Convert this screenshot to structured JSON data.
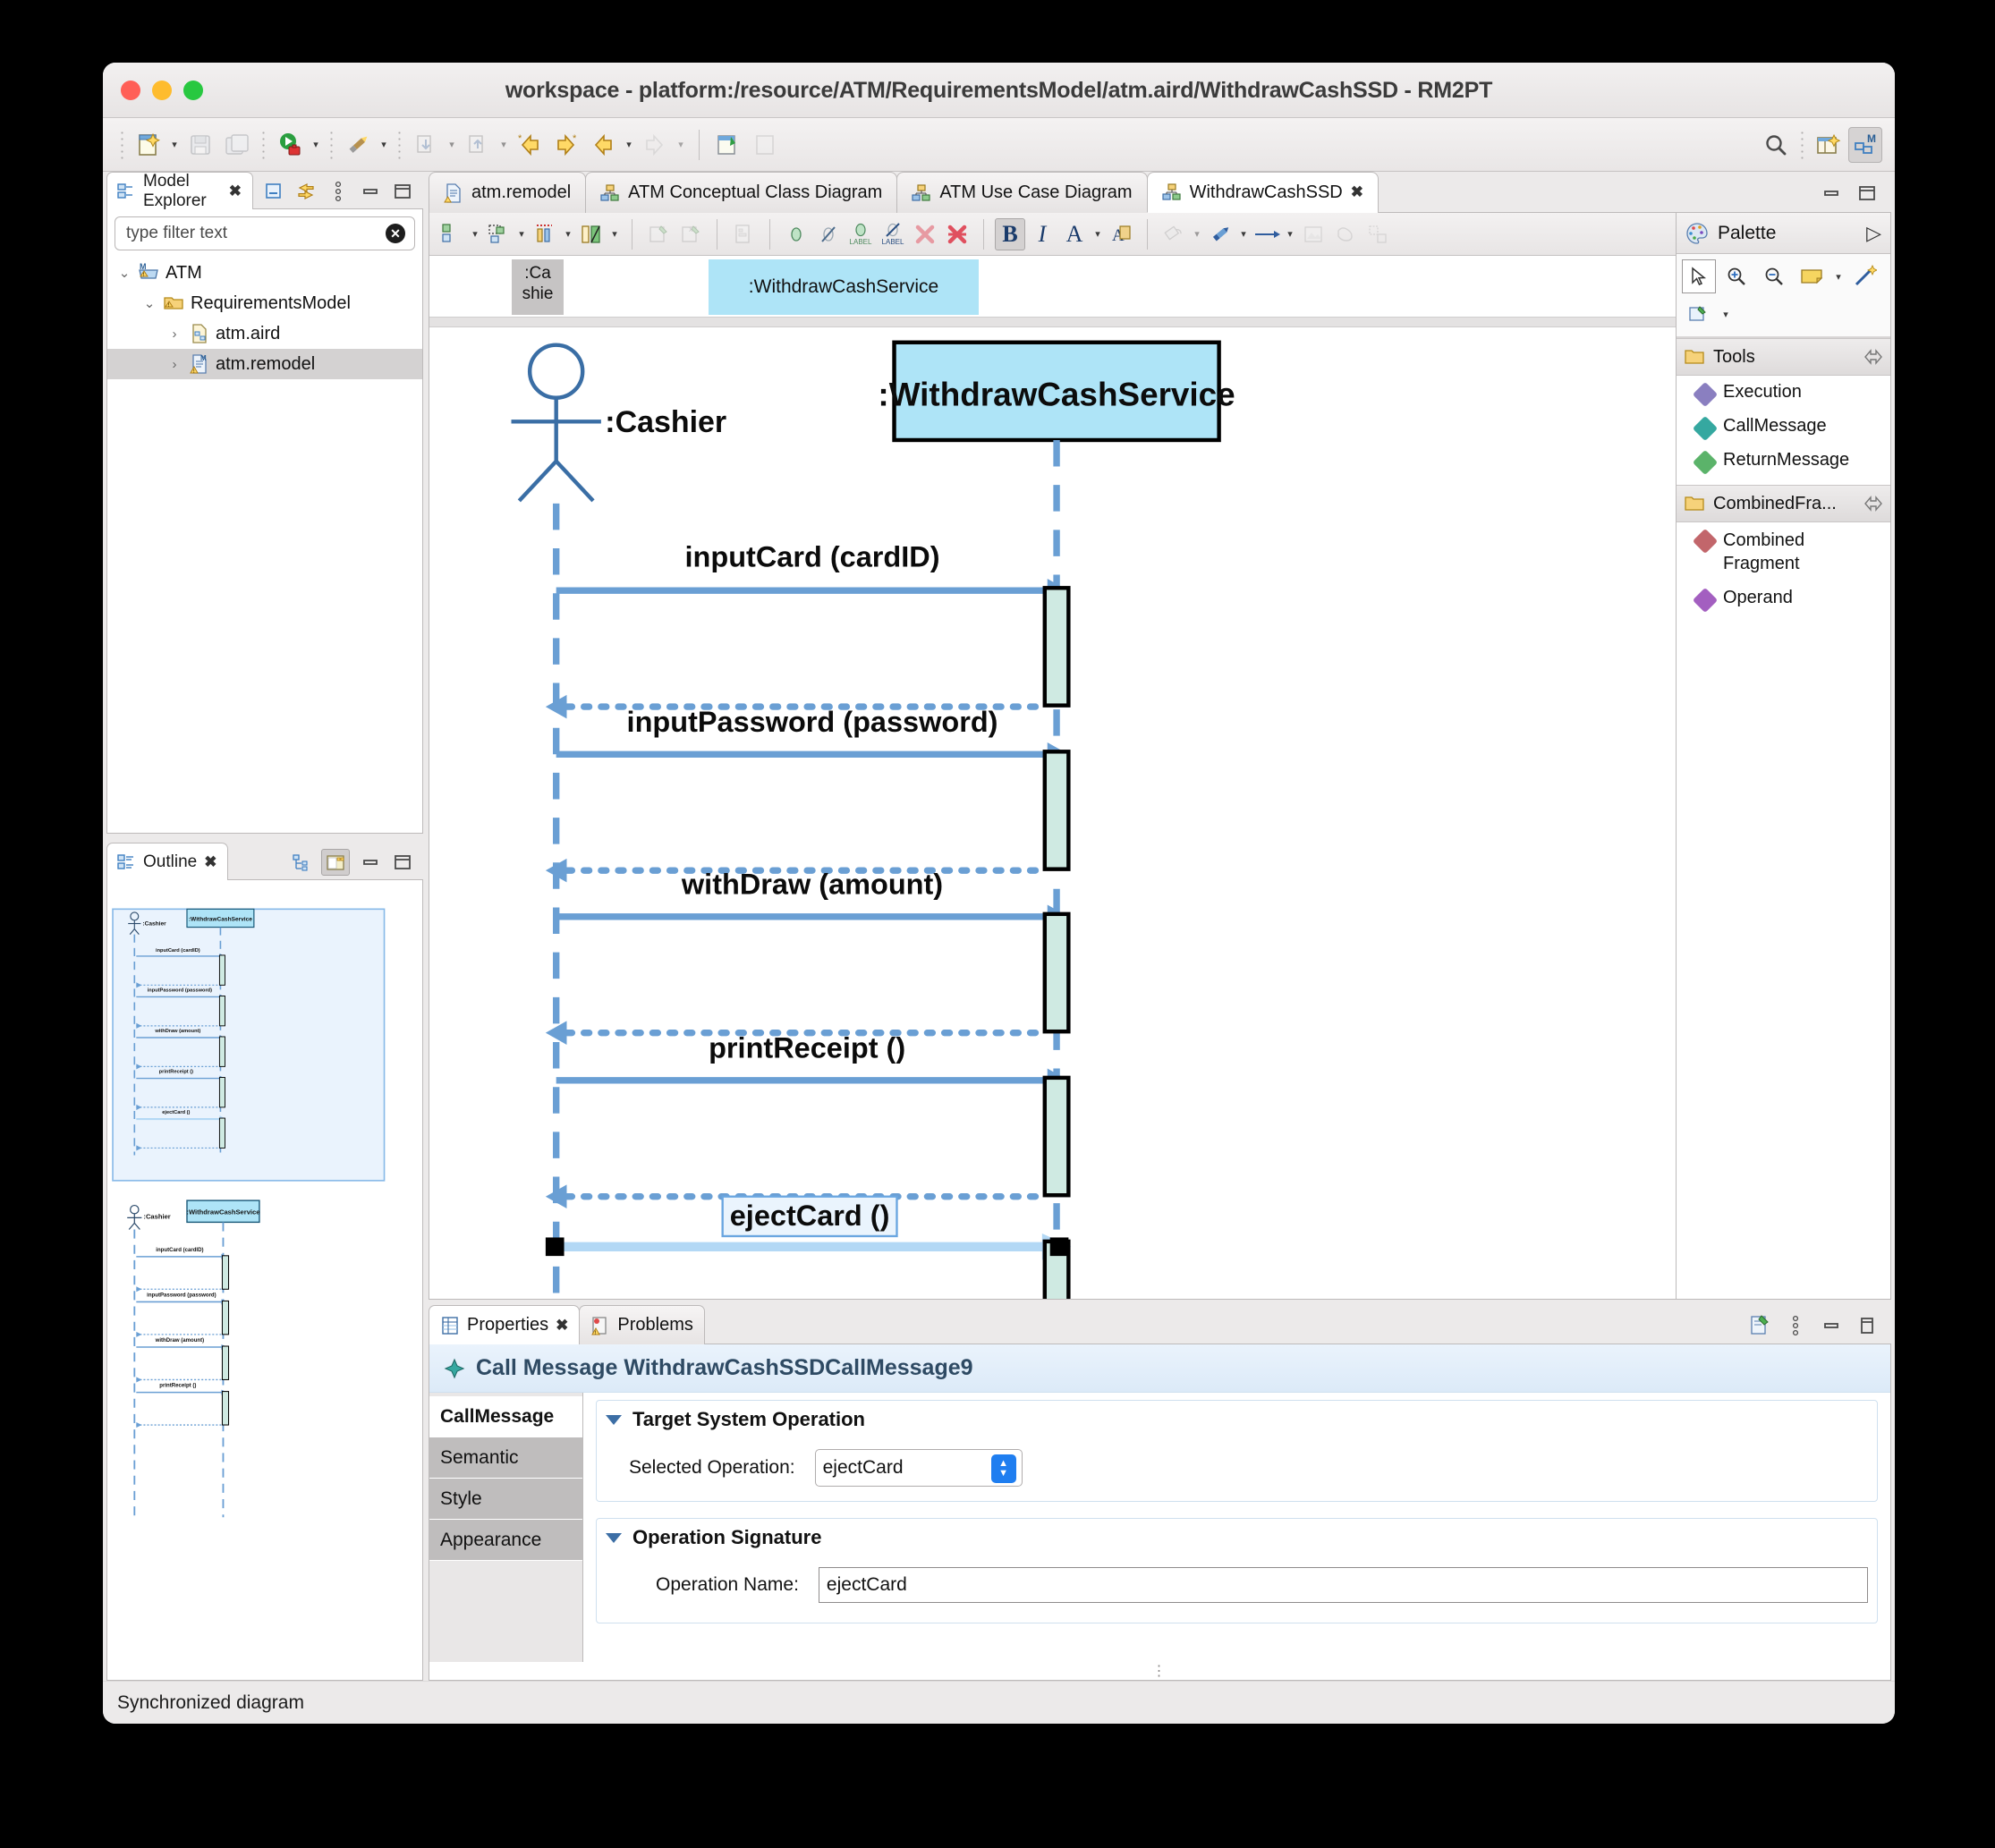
{
  "window": {
    "title": "workspace - platform:/resource/ATM/RequirementsModel/atm.aird/WithdrawCashSSD - RM2PT",
    "traffic": {
      "close": "close-button",
      "minimize": "minimize-button",
      "zoom": "zoom-button"
    }
  },
  "main_toolbar": {
    "items": [
      {
        "name": "new-wizard",
        "glyph": "new",
        "caret": true,
        "enabled": true
      },
      {
        "name": "save",
        "glyph": "save",
        "caret": false,
        "enabled": false
      },
      {
        "name": "save-all",
        "glyph": "save-all",
        "caret": false,
        "enabled": false
      },
      {
        "name": "run",
        "glyph": "run",
        "caret": true,
        "enabled": true
      },
      {
        "name": "validate",
        "glyph": "pencil",
        "caret": true,
        "enabled": true
      },
      {
        "name": "import",
        "glyph": "import",
        "caret": true,
        "enabled": false
      },
      {
        "name": "export",
        "glyph": "export",
        "caret": true,
        "enabled": false
      },
      {
        "name": "previous-annotation",
        "glyph": "prev-annot",
        "caret": false,
        "enabled": true
      },
      {
        "name": "next-annotation",
        "glyph": "next-annot",
        "caret": false,
        "enabled": true
      },
      {
        "name": "back",
        "glyph": "back",
        "caret": true,
        "enabled": true
      },
      {
        "name": "forward",
        "glyph": "forward",
        "caret": true,
        "enabled": false
      },
      {
        "name": "new-representation",
        "glyph": "new-repr",
        "caret": false,
        "enabled": true
      },
      {
        "name": "open-representation",
        "glyph": "open-repr",
        "caret": false,
        "enabled": false
      }
    ],
    "right_items": [
      {
        "name": "search-icon",
        "glyph": "search"
      },
      {
        "name": "open-perspective",
        "glyph": "perspective"
      },
      {
        "name": "modeling-perspective",
        "glyph": "modeling",
        "active": true
      }
    ]
  },
  "model_explorer": {
    "tab_label": "Model Explorer",
    "close_glyph": "✖",
    "toolbar": [
      {
        "name": "collapse-all-icon"
      },
      {
        "name": "link-with-editor-icon"
      },
      {
        "name": "view-menu-icon"
      },
      {
        "name": "minimize-icon"
      },
      {
        "name": "maximize-icon"
      }
    ],
    "filter_placeholder": "type filter text",
    "filter_value": "",
    "tree": [
      {
        "label": "ATM",
        "depth": 0,
        "expanded": true,
        "icon": "model-project-icon",
        "warning": true,
        "selected": false
      },
      {
        "label": "RequirementsModel",
        "depth": 1,
        "expanded": true,
        "icon": "folder-icon",
        "warning": true,
        "selected": false
      },
      {
        "label": "atm.aird",
        "depth": 2,
        "expanded": false,
        "icon": "aird-file-icon",
        "warning": false,
        "selected": false
      },
      {
        "label": "atm.remodel",
        "depth": 2,
        "expanded": false,
        "icon": "remodel-file-icon",
        "warning": true,
        "selected": true
      }
    ]
  },
  "outline": {
    "tab_label": "Outline",
    "close_glyph": "✖",
    "toolbar": [
      {
        "name": "outline-tree-view-icon",
        "active": false
      },
      {
        "name": "outline-overview-icon",
        "active": true
      },
      {
        "name": "minimize-icon",
        "active": false
      },
      {
        "name": "maximize-icon",
        "active": false
      }
    ]
  },
  "editor": {
    "tabs": [
      {
        "label": "atm.remodel",
        "icon": "remodel-file-icon",
        "active": false,
        "closable": false
      },
      {
        "label": "ATM Conceptual Class Diagram",
        "icon": "diagram-icon",
        "active": false,
        "closable": false
      },
      {
        "label": "ATM Use Case Diagram",
        "icon": "diagram-icon",
        "active": false,
        "closable": false
      },
      {
        "label": "WithdrawCashSSD",
        "icon": "diagram-icon",
        "active": true,
        "closable": true
      }
    ],
    "tab_controls": [
      {
        "name": "minimize-icon"
      },
      {
        "name": "maximize-icon"
      }
    ],
    "diagram_toolbar": [
      {
        "name": "align-icon",
        "caret": true,
        "enabled": true
      },
      {
        "name": "distribute-icon",
        "caret": true,
        "enabled": true
      },
      {
        "name": "auto-size-icon",
        "caret": true,
        "enabled": true
      },
      {
        "name": "arrange-icon",
        "caret": true,
        "enabled": true
      },
      {
        "name": "pin-icon",
        "caret": false,
        "enabled": false
      },
      {
        "name": "unpin-icon",
        "caret": false,
        "enabled": false
      },
      {
        "name": "paste-format-icon",
        "caret": false,
        "enabled": false
      },
      {
        "name": "show-hide-icon",
        "caret": false,
        "enabled": true
      },
      {
        "name": "hide-element-icon",
        "caret": false,
        "enabled": true
      },
      {
        "name": "show-label-icon",
        "caret": false,
        "enabled": true
      },
      {
        "name": "hide-label-icon",
        "caret": false,
        "enabled": true
      },
      {
        "name": "delete-from-diagram-icon",
        "caret": false,
        "enabled": true
      },
      {
        "name": "delete-from-model-icon",
        "caret": false,
        "enabled": true
      },
      {
        "name": "bold-icon",
        "caret": false,
        "enabled": true,
        "active": true,
        "text": "B"
      },
      {
        "name": "italic-icon",
        "caret": false,
        "enabled": true,
        "text": "I"
      },
      {
        "name": "font-color-icon",
        "caret": true,
        "enabled": true,
        "text": "A"
      },
      {
        "name": "font-dialog-icon",
        "caret": false,
        "enabled": true
      },
      {
        "name": "fill-color-icon",
        "caret": true,
        "enabled": false
      },
      {
        "name": "line-color-icon",
        "caret": true,
        "enabled": true
      },
      {
        "name": "line-style-icon",
        "caret": true,
        "enabled": true
      },
      {
        "name": "image-icon",
        "caret": false,
        "enabled": false
      },
      {
        "name": "shape-icon",
        "caret": false,
        "enabled": false
      },
      {
        "name": "layers-icon",
        "caret": false,
        "enabled": false
      }
    ],
    "header_strip": {
      "cashier_label": ":Ca shie",
      "service_label": ":WithdrawCashService"
    }
  },
  "diagram": {
    "title": "WithdrawCashSSD",
    "actor": {
      "name": ":Cashier",
      "type": "actor"
    },
    "participant": {
      "name": ":WithdrawCashService",
      "type": "system",
      "fill": "#aee4f7"
    },
    "messages": [
      {
        "label": "inputCard (cardID)",
        "kind": "call",
        "selected": false
      },
      {
        "label": "",
        "kind": "return",
        "selected": false
      },
      {
        "label": "inputPassword (password)",
        "kind": "call",
        "selected": false
      },
      {
        "label": "",
        "kind": "return",
        "selected": false
      },
      {
        "label": "withDraw (amount)",
        "kind": "call",
        "selected": false
      },
      {
        "label": "",
        "kind": "return",
        "selected": false
      },
      {
        "label": "printReceipt ()",
        "kind": "call",
        "selected": false
      },
      {
        "label": "",
        "kind": "return",
        "selected": false
      },
      {
        "label": "ejectCard ()",
        "kind": "call",
        "selected": true
      },
      {
        "label": "",
        "kind": "return",
        "selected": false
      }
    ],
    "colors": {
      "lifeline": "#6a9fd4",
      "execution_fill": "#cfeae2",
      "participant_fill": "#aee4f7",
      "selection": "#b3d8f5"
    }
  },
  "palette": {
    "title": "Palette",
    "collapse_glyph": "▷",
    "tools_row": [
      {
        "name": "select-tool-icon",
        "selected": true
      },
      {
        "name": "zoom-in-tool-icon",
        "selected": false
      },
      {
        "name": "zoom-out-tool-icon",
        "selected": false
      },
      {
        "name": "note-tool-icon",
        "selected": false,
        "caret": true
      },
      {
        "name": "note-attachment-tool-icon",
        "selected": false
      },
      {
        "name": "generic-link-tool-icon",
        "selected": false,
        "caret": true
      }
    ],
    "groups": [
      {
        "label": "Tools",
        "pin_icon": "pin-group-icon",
        "items": [
          {
            "label": "Execution",
            "color": "#8a7fc0"
          },
          {
            "label": "CallMessage",
            "color": "#35a8a0"
          },
          {
            "label": "ReturnMessage",
            "color": "#5bb36a"
          }
        ]
      },
      {
        "label": "CombinedFra...",
        "pin_icon": "pin-group-icon",
        "items": [
          {
            "label": "Combined Fragment",
            "color": "#c2666b"
          },
          {
            "label": "Operand",
            "color": "#a35fc0"
          }
        ]
      }
    ]
  },
  "properties": {
    "tabs": [
      {
        "label": "Properties",
        "icon": "properties-icon",
        "active": true,
        "closable": true
      },
      {
        "label": "Problems",
        "icon": "problems-icon",
        "active": false,
        "closable": false
      }
    ],
    "tab_controls": [
      {
        "name": "pin-editor-icon"
      },
      {
        "name": "view-menu-icon"
      },
      {
        "name": "minimize-icon"
      },
      {
        "name": "maximize-icon"
      }
    ],
    "title": "Call Message WithdrawCashSSDCallMessage9",
    "title_icon": "call-message-icon",
    "side_tabs": [
      {
        "label": "CallMessage",
        "active": true
      },
      {
        "label": "Semantic",
        "active": false
      },
      {
        "label": "Style",
        "active": false
      },
      {
        "label": "Appearance",
        "active": false
      }
    ],
    "sections": [
      {
        "name": "target-system-operation",
        "heading": "Target System Operation",
        "field_label": "Selected Operation:",
        "field_value": "ejectCard",
        "field_kind": "combo"
      },
      {
        "name": "operation-signature",
        "heading": "Operation Signature",
        "field_label": "Operation Name:",
        "field_value": "ejectCard",
        "field_kind": "text"
      }
    ]
  },
  "status_bar": {
    "message": "Synchronized diagram"
  }
}
